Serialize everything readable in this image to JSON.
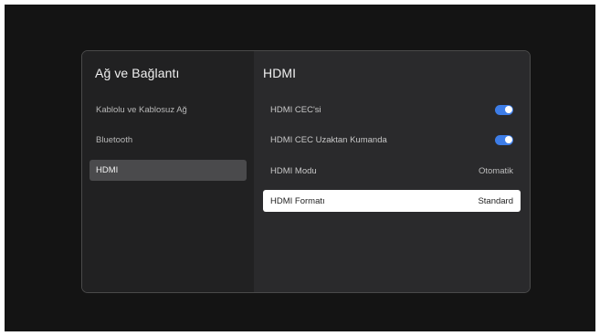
{
  "left_panel": {
    "title": "Ağ ve Bağlantı",
    "items": [
      {
        "label": "Kablolu ve Kablosuz Ağ",
        "selected": false
      },
      {
        "label": "Bluetooth",
        "selected": false
      },
      {
        "label": "HDMI",
        "selected": true
      }
    ]
  },
  "right_panel": {
    "title": "HDMI",
    "settings": [
      {
        "label": "HDMI CEC'si",
        "type": "toggle",
        "value": "on"
      },
      {
        "label": "HDMI CEC Uzaktan Kumanda",
        "type": "toggle",
        "value": "on"
      },
      {
        "label": "HDMI Modu",
        "type": "value",
        "value": "Otomatik"
      },
      {
        "label": "HDMI Formatı",
        "type": "value",
        "value": "Standard",
        "focused": true
      }
    ]
  },
  "colors": {
    "accent": "#3d7de8",
    "background": "#141414",
    "panel_left": "#212122",
    "panel_right": "#2a2a2c",
    "selected_item": "#4a4a4c",
    "focused_row": "#ffffff"
  }
}
